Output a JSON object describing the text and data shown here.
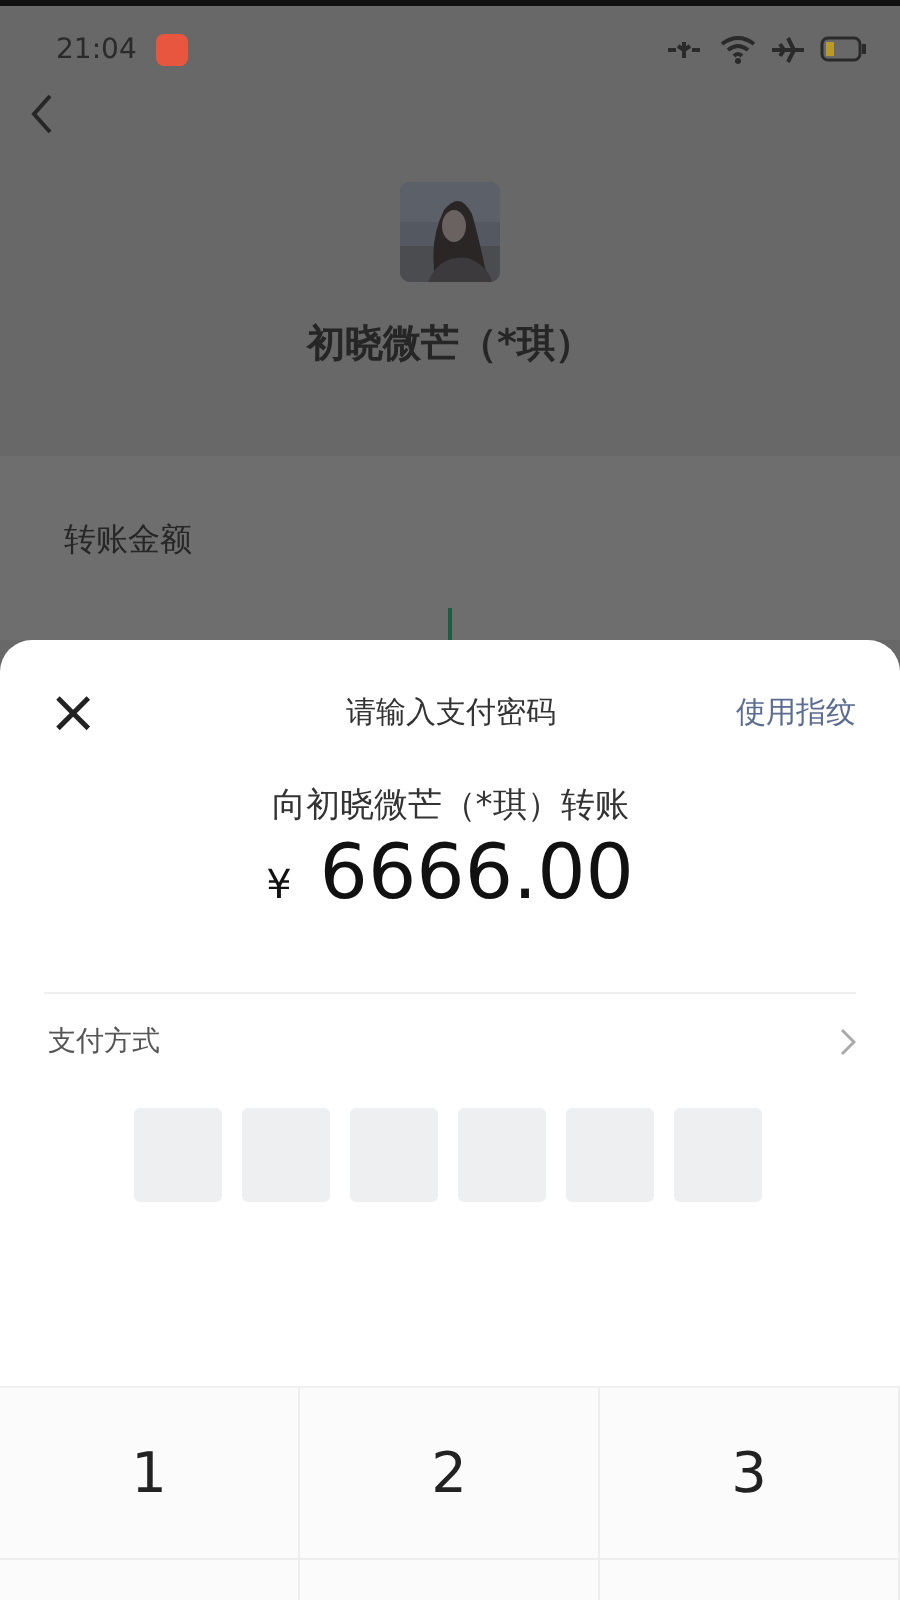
{
  "status_bar": {
    "time": "21:04"
  },
  "payee": {
    "name": "初晓微芒（*琪）"
  },
  "amount_card": {
    "label": "转账金额"
  },
  "pay_sheet": {
    "close": "×",
    "title": "请输入支付密码",
    "fingerprint_link": "使用指纹",
    "recipient": "向初晓微芒（*琪）转账",
    "currency": "¥",
    "amount": "6666.00",
    "payment_method": {
      "label": "支付方式"
    },
    "password_boxes": [
      {
        "filled": false
      },
      {
        "filled": false
      },
      {
        "filled": false
      },
      {
        "filled": false
      },
      {
        "filled": false
      },
      {
        "filled": false
      }
    ]
  },
  "keypad": {
    "keys": [
      "1",
      "2",
      "3"
    ]
  }
}
